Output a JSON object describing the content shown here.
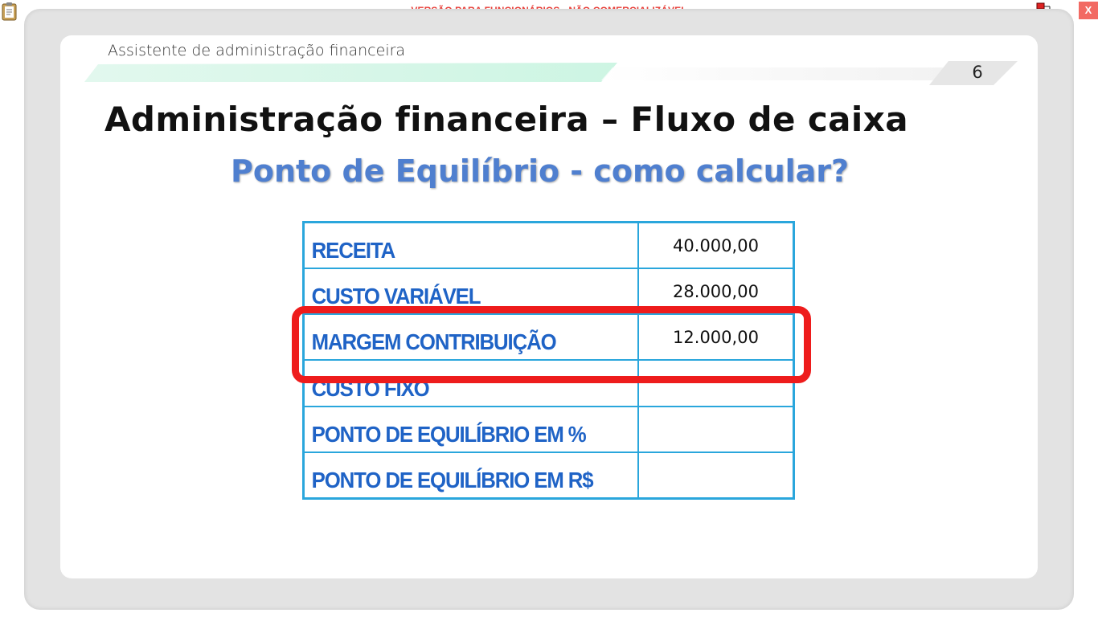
{
  "topbar": {
    "banner": "VERSÃO PARA FUNCIONÁRIOS - NÃO COMERCIALIZÁVEL",
    "close_label": "X",
    "icons": [
      "clipboard-icon",
      "network-icon"
    ]
  },
  "slide": {
    "course": "Assistente de administração financeira",
    "page": "6",
    "title": "Administração financeira – Fluxo de caixa",
    "subtitle": "Ponto de Equilíbrio - como calcular?",
    "table": {
      "rows": [
        {
          "label": "RECEITA",
          "value": "40.000,00"
        },
        {
          "label": "CUSTO VARIÁVEL",
          "value": "28.000,00"
        },
        {
          "label": "MARGEM CONTRIBUIÇÃO",
          "value": "12.000,00"
        },
        {
          "label": "CUSTO FIXO",
          "value": ""
        },
        {
          "label": "PONTO DE EQUILÍBRIO EM  %",
          "value": ""
        },
        {
          "label": "PONTO DE EQUILÍBRIO EM R$",
          "value": ""
        }
      ]
    }
  },
  "colors": {
    "banner": "#e8413b",
    "subtitle": "#4f7fcf",
    "table_text": "#1f63c6",
    "table_border": "#2aa6dc",
    "highlight": "#ee1c1c",
    "close_button": "#f26a63"
  }
}
